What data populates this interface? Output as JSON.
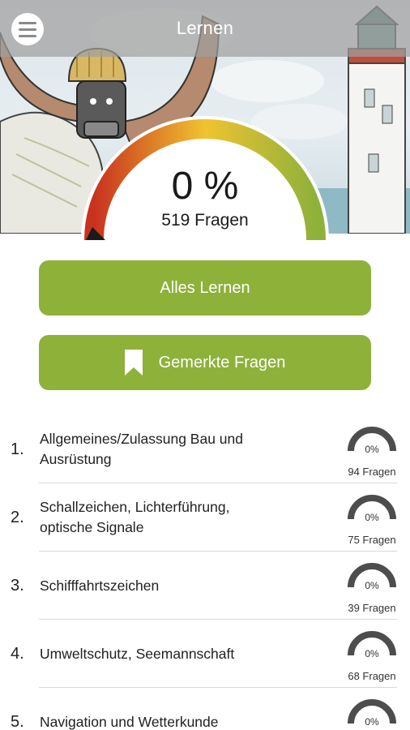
{
  "header": {
    "title": "Lernen"
  },
  "progress": {
    "percent_label": "0 %",
    "fraction": 0,
    "count_label": "519 Fragen"
  },
  "actions": {
    "learn_all": "Alles Lernen",
    "bookmarked": "Gemerkte Fragen"
  },
  "colors": {
    "accent": "#8eb13a",
    "gauge_low": "#c8321e",
    "gauge_mid": "#f0c330",
    "gauge_high": "#8eb13a",
    "mini_gauge": "#4d4d4d"
  },
  "categories": [
    {
      "num": "1.",
      "title": "Allgemeines/Zulassung Bau und Ausrüstung",
      "percent": "0%",
      "count": "94 Fragen"
    },
    {
      "num": "2.",
      "title": "Schallzeichen, Lichterführung, optische Signale",
      "percent": "0%",
      "count": "75 Fragen"
    },
    {
      "num": "3.",
      "title": "Schifffahrtszeichen",
      "percent": "0%",
      "count": "39 Fragen"
    },
    {
      "num": "4.",
      "title": "Umweltschutz, Seemannschaft",
      "percent": "0%",
      "count": "68 Fragen"
    },
    {
      "num": "5.",
      "title": "Navigation und Wetterkunde",
      "percent": "0%",
      "count": ""
    }
  ]
}
